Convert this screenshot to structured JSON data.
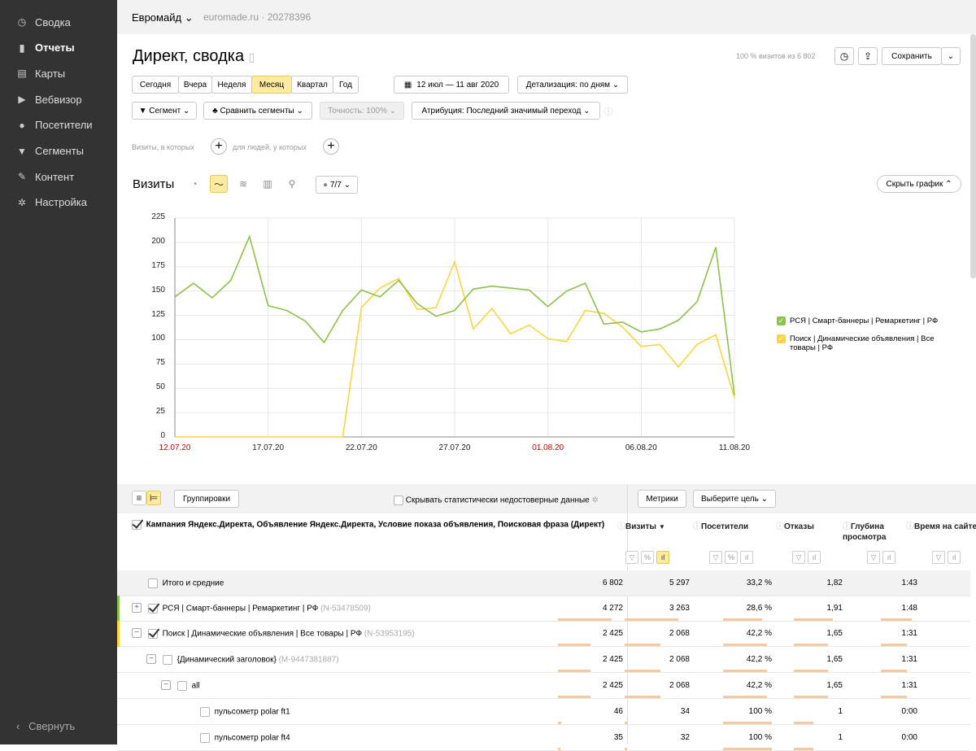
{
  "sidebar": {
    "items": [
      {
        "label": "Сводка",
        "icon": "gauge-icon",
        "glyph": "◷"
      },
      {
        "label": "Отчеты",
        "icon": "bar-chart-icon",
        "glyph": "▮"
      },
      {
        "label": "Карты",
        "icon": "map-icon",
        "glyph": "▤"
      },
      {
        "label": "Вебвизор",
        "icon": "play-icon",
        "glyph": "▶"
      },
      {
        "label": "Посетители",
        "icon": "person-icon",
        "glyph": "●"
      },
      {
        "label": "Сегменты",
        "icon": "funnel-icon",
        "glyph": "▼"
      },
      {
        "label": "Контент",
        "icon": "pencil-icon",
        "glyph": "✎"
      },
      {
        "label": "Настройка",
        "icon": "gear-icon",
        "glyph": "✲"
      }
    ],
    "active_index": 1,
    "collapse": "Свернуть"
  },
  "topbar": {
    "counter_name": "Евромайд",
    "site": "euromade.ru",
    "counter_id": "· 20278396"
  },
  "header": {
    "title": "Директ, сводка",
    "visits_info": "100 % визитов из 6 802",
    "save": "Сохранить"
  },
  "periods": [
    "Сегодня",
    "Вчера",
    "Неделя",
    "Месяц",
    "Квартал",
    "Год"
  ],
  "active_period": "Месяц",
  "date_range": "12 июл — 11 авг 2020",
  "detail": "Детализация: по дням",
  "filters": {
    "segment": "Сегмент",
    "compare": "Сравнить сегменты",
    "accuracy": "Точность: 100%",
    "attribution": "Атрибуция: Последний значимый переход"
  },
  "condition": {
    "visits": "Визиты, в которых",
    "people": "для людей, у которых"
  },
  "chart_header": {
    "title": "Визиты",
    "series_count": "7/7",
    "hide": "Скрыть график"
  },
  "chart_data": {
    "type": "line",
    "x": [
      "12.07.20",
      "13.07.20",
      "14.07.20",
      "15.07.20",
      "16.07.20",
      "17.07.20",
      "18.07.20",
      "19.07.20",
      "20.07.20",
      "21.07.20",
      "22.07.20",
      "23.07.20",
      "24.07.20",
      "25.07.20",
      "26.07.20",
      "27.07.20",
      "28.07.20",
      "29.07.20",
      "30.07.20",
      "31.07.20",
      "01.08.20",
      "02.08.20",
      "03.08.20",
      "04.08.20",
      "05.08.20",
      "06.08.20",
      "07.08.20",
      "08.08.20",
      "09.08.20",
      "10.08.20",
      "11.08.20"
    ],
    "x_tick_labels": [
      "12.07.20",
      "17.07.20",
      "22.07.20",
      "27.07.20",
      "01.08.20",
      "06.08.20",
      "11.08.20"
    ],
    "x_tick_red": [
      "12.07.20",
      "01.08.20"
    ],
    "ylim": [
      0,
      225
    ],
    "y_ticks": [
      0,
      25,
      50,
      75,
      100,
      125,
      150,
      175,
      200,
      225
    ],
    "grid": true,
    "legend_position": "right",
    "series": [
      {
        "name": "РСЯ | Смарт-баннеры | Ремаркетинг | РФ",
        "color": "#8bc34a",
        "values": [
          144,
          158,
          143,
          161,
          206,
          135,
          130,
          119,
          97,
          130,
          151,
          144,
          161,
          137,
          124,
          130,
          152,
          155,
          153,
          151,
          134,
          150,
          158,
          116,
          118,
          108,
          111,
          120,
          139,
          195,
          43
        ]
      },
      {
        "name": "Поиск | Динамические объявления | Все товары | РФ",
        "color": "#ffd33d",
        "values": [
          0,
          0,
          0,
          0,
          0,
          0,
          0,
          0,
          0,
          0,
          133,
          153,
          163,
          131,
          133,
          180,
          111,
          132,
          106,
          115,
          101,
          98,
          130,
          127,
          113,
          93,
          95,
          72,
          95,
          105,
          40
        ]
      }
    ]
  },
  "table_toolbar": {
    "groupings": "Группировки",
    "hide_unreliable": "Скрывать статистически недостоверные данные",
    "metrics": "Метрики",
    "goal": "Выберите цель"
  },
  "table": {
    "dimension_header": "Кампания Яндекс.Директа, Объявление Яндекс.Директа, Условие показа объявления, Поисковая фраза (Директ)",
    "columns": [
      {
        "label": "Визиты",
        "sort": "▼"
      },
      {
        "label": "Посетители",
        "sort": ""
      },
      {
        "label": "Отказы",
        "sort": ""
      },
      {
        "label": "Глубина просмотра",
        "sort": ""
      },
      {
        "label": "Время на сайте",
        "sort": ""
      }
    ],
    "rows": [
      {
        "label": "Итого и средние",
        "id": "",
        "values": [
          "6 802",
          "5 297",
          "33,2 %",
          "1,82",
          "1:43"
        ],
        "bars": [
          0,
          0,
          0,
          0,
          0
        ]
      },
      {
        "label": "РСЯ | Смарт-баннеры | Ремаркетинг | РФ",
        "id": "(N-53478509)",
        "values": [
          "4 272",
          "3 263",
          "28,6 %",
          "1,91",
          "1:48"
        ],
        "bars": [
          0.83,
          0.83,
          0.8,
          0.8,
          0.85
        ]
      },
      {
        "label": "Поиск | Динамические объявления | Все товары | РФ",
        "id": "(N-53953195)",
        "values": [
          "2 425",
          "2 068",
          "42,2 %",
          "1,65",
          "1:31"
        ],
        "bars": [
          0.5,
          0.55,
          0.9,
          0.7,
          0.7
        ]
      },
      {
        "label": "{Динамический заголовок}",
        "id": "(M-9447381887)",
        "values": [
          "2 425",
          "2 068",
          "42,2 %",
          "1,65",
          "1:31"
        ],
        "bars": [
          0.5,
          0.55,
          0.9,
          0.7,
          0.7
        ]
      },
      {
        "label": "all",
        "id": "",
        "values": [
          "2 425",
          "2 068",
          "42,2 %",
          "1,65",
          "1:31"
        ],
        "bars": [
          0.5,
          0.55,
          0.9,
          0.7,
          0.7
        ]
      },
      {
        "label": "пульсометр polar ft1",
        "id": "",
        "values": [
          "46",
          "34",
          "100 %",
          "1",
          "0:00"
        ],
        "bars": [
          0.05,
          0.05,
          1,
          0.4,
          0
        ]
      },
      {
        "label": "пульсометр polar ft4",
        "id": "",
        "values": [
          "35",
          "32",
          "100 %",
          "1",
          "0:00"
        ],
        "bars": [
          0.04,
          0.04,
          1,
          0.4,
          0
        ]
      }
    ]
  }
}
